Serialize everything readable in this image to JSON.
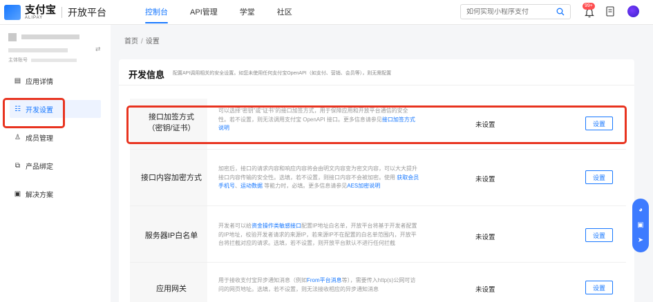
{
  "logo": {
    "cn": "支付宝",
    "en": "ALIPAY",
    "platform": "开放平台"
  },
  "nav": [
    "控制台",
    "API管理",
    "学堂",
    "社区"
  ],
  "search": {
    "placeholder": "如何实现小程序支付"
  },
  "notifications": {
    "badge": "99+"
  },
  "account": {
    "id_label": "主体账号"
  },
  "sidebar": {
    "items": [
      {
        "label": "应用详情",
        "icon": "app-detail-icon"
      },
      {
        "label": "开发设置",
        "icon": "dev-settings-icon",
        "active": true
      },
      {
        "label": "成员管理",
        "icon": "members-icon"
      },
      {
        "label": "产品绑定",
        "icon": "product-bind-icon"
      },
      {
        "label": "解决方案",
        "icon": "solution-icon"
      }
    ]
  },
  "breadcrumb": {
    "home": "首页",
    "sep": "/",
    "current": "设置"
  },
  "panel": {
    "title": "开发信息",
    "desc": "配置API调用相关的安全设置。如您未使用任何支付宝OpenAPI（如支付、营销、会员等），则无需配置"
  },
  "rows": [
    {
      "label_line1": "接口加签方式",
      "label_line2": "（密钥/证书）",
      "desc_line1": "可以选择“密钥”或“证书”的接口加签方式，用于保障应用和开放平台通信的安全",
      "desc_line2": "性。若不设置，则无法调用支付宝 OpenAPI 接口。更多信息请参见",
      "desc_link": "接口加签方式",
      "desc_line3": "说明",
      "status": "未设置",
      "button": "设置"
    },
    {
      "label": "接口内容加密方式",
      "desc_line1": "加密后，接口的请求内容和响应内容将会由明文内容变为密文内容，可以大大提升",
      "desc_line2a": "接口内容传输的安全性。选填，若不设置，则接口内容不会被加密。使用 ",
      "desc_link1": "获取会员",
      "desc_link2": "手机号",
      "desc_sep": "、",
      "desc_link3": "运动数据",
      "desc_line3b": " 等能力时，必填。更多信息请参见",
      "desc_link4": "AES加密说明",
      "status": "未设置",
      "button": "设置"
    },
    {
      "label": "服务器IP白名单",
      "desc_line1a": "开发者可以给",
      "desc_link": "资金操作类敏感接口",
      "desc_line1b": "配置IP地址白名单，开放平台将基于开发者配置",
      "desc_line2": "的IP地址，校验开发者请求的来源IP，若来源IP不在配置的白名单范围内，开放平",
      "desc_line3": "台将拦截对应的请求。选填，若不设置，则开放平台默认不进行任何拦截",
      "status": "未设置",
      "button": "设置"
    },
    {
      "label": "应用网关",
      "desc_line1a": "用于接收支付宝异步通知消息（例如",
      "desc_link": "From平台消息",
      "desc_line1b": "等），需要传入http(s)公网可访",
      "desc_line2": "问的网页地址。选填，若不设置，则无法接收相应的异步通知消息",
      "status": "未设置",
      "button": "设置"
    }
  ],
  "colors": {
    "accent": "#1677ff",
    "highlight": "#e8331f"
  }
}
